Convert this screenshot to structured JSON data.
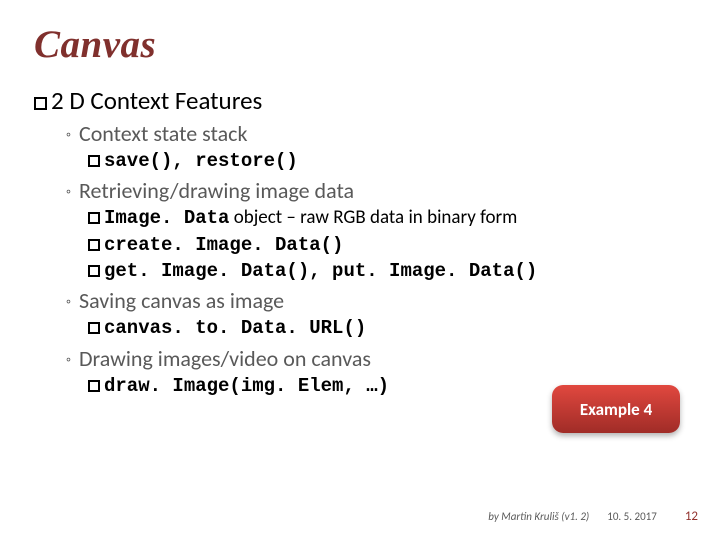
{
  "title": "Canvas",
  "h1_prefix": "2 D",
  "h1_rest": " Context Features",
  "items": [
    {
      "label": "Context state stack",
      "leaves": [
        {
          "code": "save(), restore()",
          "tail": ""
        }
      ]
    },
    {
      "label": "Retrieving/drawing image data",
      "leaves": [
        {
          "code": "Image. Data",
          "tail": " object – raw RGB data in binary form"
        },
        {
          "code": "create. Image. Data()",
          "tail": ""
        },
        {
          "code": "get. Image. Data(), put. Image. Data()",
          "tail": ""
        }
      ]
    },
    {
      "label": "Saving canvas as image",
      "leaves": [
        {
          "code": "canvas. to. Data. URL()",
          "tail": ""
        }
      ]
    },
    {
      "label": "Drawing images/video on canvas",
      "leaves": [
        {
          "code": "draw. Image(img. Elem, …)",
          "tail": ""
        }
      ]
    }
  ],
  "badge": "Example 4",
  "footer": {
    "author": "by Martin Kruliš (v1. 2)",
    "date": "10. 5. 2017",
    "page": "12"
  }
}
